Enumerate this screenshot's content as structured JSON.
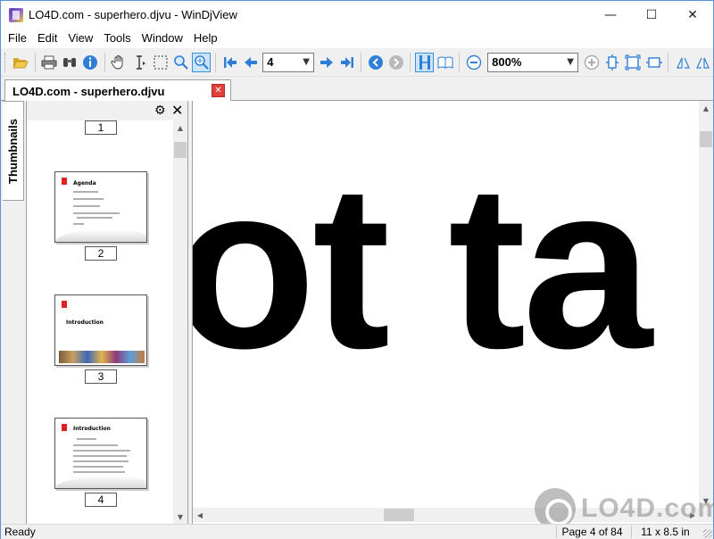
{
  "window": {
    "title": "LO4D.com - superhero.djvu - WinDjView",
    "controls": {
      "minimize": "—",
      "maximize": "☐",
      "close": "✕"
    }
  },
  "menu": [
    "File",
    "Edit",
    "View",
    "Tools",
    "Window",
    "Help"
  ],
  "toolbar": {
    "page_value": "4",
    "zoom_value": "800%",
    "icons": [
      "open-icon",
      "print-icon",
      "find-icon",
      "info-icon",
      "hand-tool-icon",
      "text-select-icon",
      "rect-select-icon",
      "zoom-rect-icon",
      "magnifier-icon",
      "first-page-icon",
      "prev-page-icon",
      "next-page-icon",
      "last-page-icon",
      "back-icon",
      "forward-icon",
      "single-page-icon",
      "facing-pages-icon",
      "zoom-out-icon",
      "zoom-in-icon",
      "fit-page-icon",
      "fit-width-icon",
      "actual-size-icon",
      "rotate-left-icon",
      "rotate-right-icon"
    ]
  },
  "document_tab": {
    "label": "LO4D.com - superhero.djvu"
  },
  "sidebar": {
    "tab_label": "Thumbnails",
    "pages": [
      {
        "num": "1"
      },
      {
        "num": "2",
        "title": "Agenda"
      },
      {
        "num": "3",
        "title": "Introduction"
      },
      {
        "num": "4",
        "title": "Introduction"
      }
    ]
  },
  "main": {
    "page_text": "ot ta"
  },
  "watermark": "LO4D.com",
  "status": {
    "ready": "Ready",
    "page": "Page 4 of 84",
    "size": "11 x 8.5 in"
  },
  "colors": {
    "accent": "#3c8ed6",
    "tab_close": "#e0403c",
    "blue_icon": "#2f7fd6"
  }
}
